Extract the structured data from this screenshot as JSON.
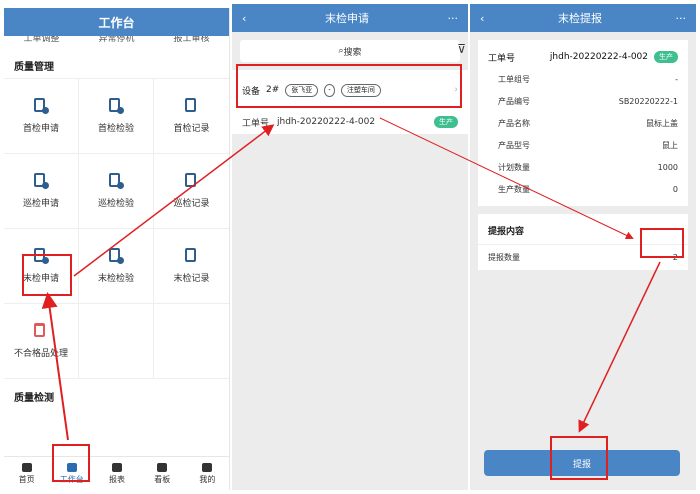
{
  "p1": {
    "title": "工作台",
    "top_row": [
      "工单调整",
      "异常停机",
      "报工审核"
    ],
    "section_quality": "质量管理",
    "grid": [
      "首检申请",
      "首检检验",
      "首检记录",
      "巡检申请",
      "巡检检验",
      "巡检记录",
      "末检申请",
      "末检检验",
      "末检记录",
      "不合格品处理",
      "",
      ""
    ],
    "section_inspection": "质量检测",
    "tabs": [
      "首页",
      "工作台",
      "报表",
      "看板",
      "我的"
    ]
  },
  "p2": {
    "title": "末检申请",
    "search_placeholder": "搜索",
    "device_label": "设备",
    "device_value": "2#",
    "device_tags": [
      "张飞亚",
      "-",
      "注塑车间"
    ],
    "order_label": "工单号",
    "order_value": "jhdh-20220222-4-002",
    "order_badge": "生产"
  },
  "p3": {
    "title": "末检提报",
    "order_label": "工单号",
    "order_value": "jhdh-20220222-4-002",
    "order_badge": "生产",
    "details": [
      {
        "k": "工单组号",
        "v": "-"
      },
      {
        "k": "产品编号",
        "v": "SB20220222-1"
      },
      {
        "k": "产品名称",
        "v": "鼠标上盖"
      },
      {
        "k": "产品型号",
        "v": "鼠上"
      },
      {
        "k": "计划数量",
        "v": "1000"
      },
      {
        "k": "生产数量",
        "v": "0"
      }
    ],
    "section_title": "提报内容",
    "submit_qty_label": "提报数量",
    "submit_qty_value": "2",
    "submit_button": "提报"
  },
  "colors": {
    "primary": "#4a86c5",
    "badge": "#3fbf8f",
    "highlight": "#e02020"
  }
}
